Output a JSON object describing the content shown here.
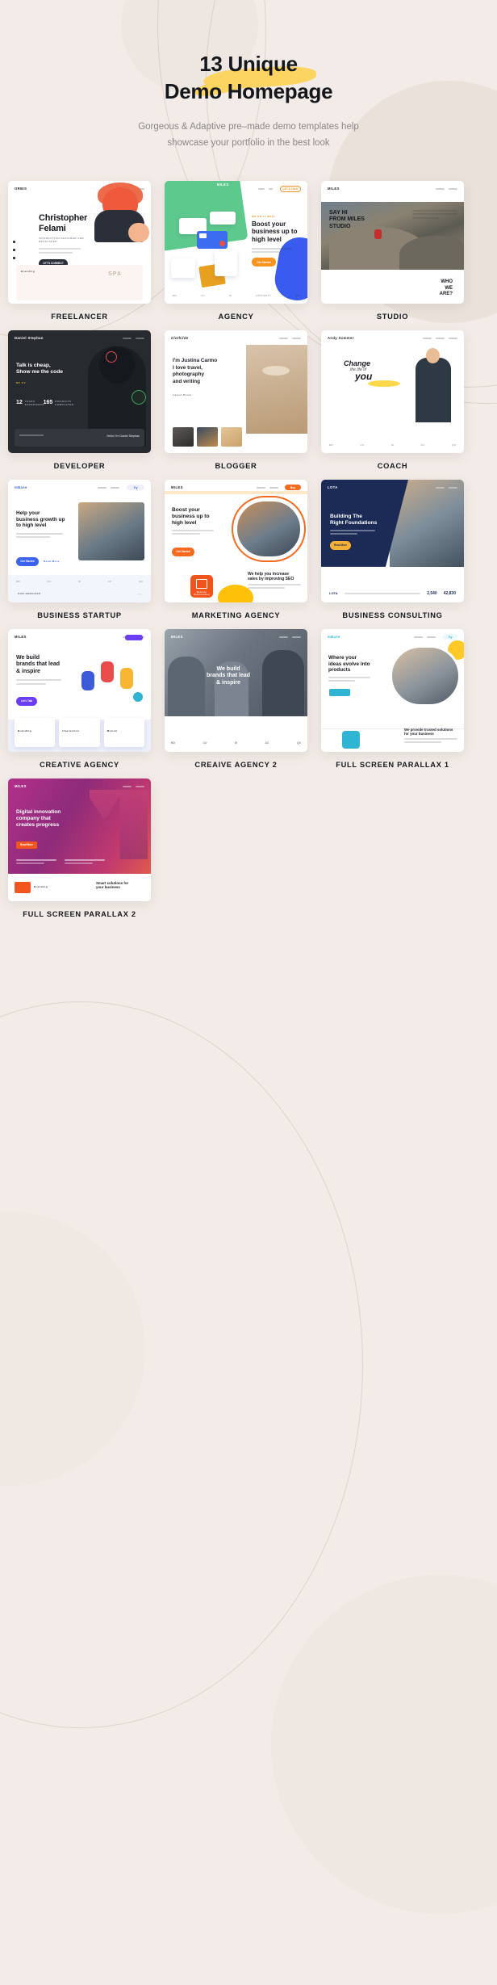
{
  "page": {
    "background_color": "#f2ebe7",
    "accent_yellow": "#fcd462"
  },
  "header": {
    "title_line1": "13 Unique",
    "title_line2": "Demo Homepage",
    "subtitle_line1": "Gorgeous & Adaptive pre–made demo templates help",
    "subtitle_line2": "showcase your portfolio in the best look"
  },
  "demos": [
    {
      "caption": "FREELANCER",
      "logo": "ORBIS",
      "heading_line1": "Christopher",
      "heading_line2": "Felami",
      "subheading": "INTERACTION DESIGNER AND DEVELOPER",
      "button": "LET'S CONNECT",
      "card_label": "Branding",
      "card_label2": "SPA"
    },
    {
      "caption": "AGENCY",
      "logo": "MILES",
      "eyebrow": "WE DO IT WELL",
      "heading_line1": "Boost your",
      "heading_line2": "business up to",
      "heading_line3": "high level",
      "button": "Get Started",
      "nav_button": "LET'S TALK"
    },
    {
      "caption": "STUDIO",
      "logo": "MILES",
      "heading_line1": "SAY HI",
      "heading_line2": "FROM MILES",
      "heading_line3": "STUDIO",
      "footer_line1": "WHO",
      "footer_line2": "WE",
      "footer_line3": "ARE?"
    },
    {
      "caption": "DEVELOPER",
      "logo": "Daniel Stephan",
      "heading_line1": "Talk is cheap,",
      "heading_line2": "Show me the code",
      "button": "MY CV",
      "stat1_value": "12",
      "stat1_label": "YEARS EXPERIENCE",
      "stat2_value": "165",
      "stat2_label": "PROJECTS COMPLETED",
      "terminal": "Hello! I'm Daniel Stephan"
    },
    {
      "caption": "BLOGGER",
      "logo": "Clothilde",
      "heading_line1": "I'm Justina Carmo",
      "heading_line2": "I love travel, photography",
      "heading_line3": "and writing",
      "section_label": "Latest Posts"
    },
    {
      "caption": "COACH",
      "logo": "Andy Sommer",
      "script_line1": "Change",
      "script_line2": "the life of",
      "script_line3": "you"
    },
    {
      "caption": "BUSINESS STARTUP",
      "logo": "mBase",
      "heading_line1": "Help your",
      "heading_line2": "business growth up",
      "heading_line3": "to high level",
      "button": "Get Started",
      "button2": "Read More",
      "footer_label": "OUR SERVICES"
    },
    {
      "caption": "MARKETING AGENCY",
      "logo": "MILES",
      "heading_line1": "Boost your",
      "heading_line2": "business up to",
      "heading_line3": "high level",
      "button": "Get Started",
      "badge": "Website Optimization",
      "side_line1": "We help you increase",
      "side_line2": "sales by improving SEO"
    },
    {
      "caption": "BUSINESS CONSULTING",
      "logo": "LOTA",
      "heading_line1": "Building The",
      "heading_line2": "Right Foundations",
      "button": "Read More",
      "stat1": "2,540",
      "stat2": "42,830"
    },
    {
      "caption": "CREATIVE AGENCY",
      "logo": "MILES",
      "heading_line1": "We build",
      "heading_line2": "brands that lead",
      "heading_line3": "& inspire",
      "button": "Let's Talk",
      "card1": "Branding",
      "card2": "Interaction",
      "card3": "Motion"
    },
    {
      "caption": "CREAIVE AGENCY 2",
      "logo": "MILES",
      "heading_line1": "We build",
      "heading_line2": "brands that lead",
      "heading_line3": "& inspire"
    },
    {
      "caption": "FULL SCREEN PARALLAX 1",
      "logo": "mBase",
      "heading_line1": "Where your",
      "heading_line2": "ideas evolve into",
      "heading_line3": "products",
      "button": "Read More",
      "side_line1": "We provide trusted solutions",
      "side_line2": "for your business"
    },
    {
      "caption": "FULL SCREEN PARALLAX 2",
      "logo": "MILES",
      "heading_line1": "Digital innovation",
      "heading_line2": "company that",
      "heading_line3": "creates progress",
      "button": "Read More",
      "footer_label": "Branding",
      "footer_line1": "Smart solutions for",
      "footer_line2": "your business"
    }
  ]
}
